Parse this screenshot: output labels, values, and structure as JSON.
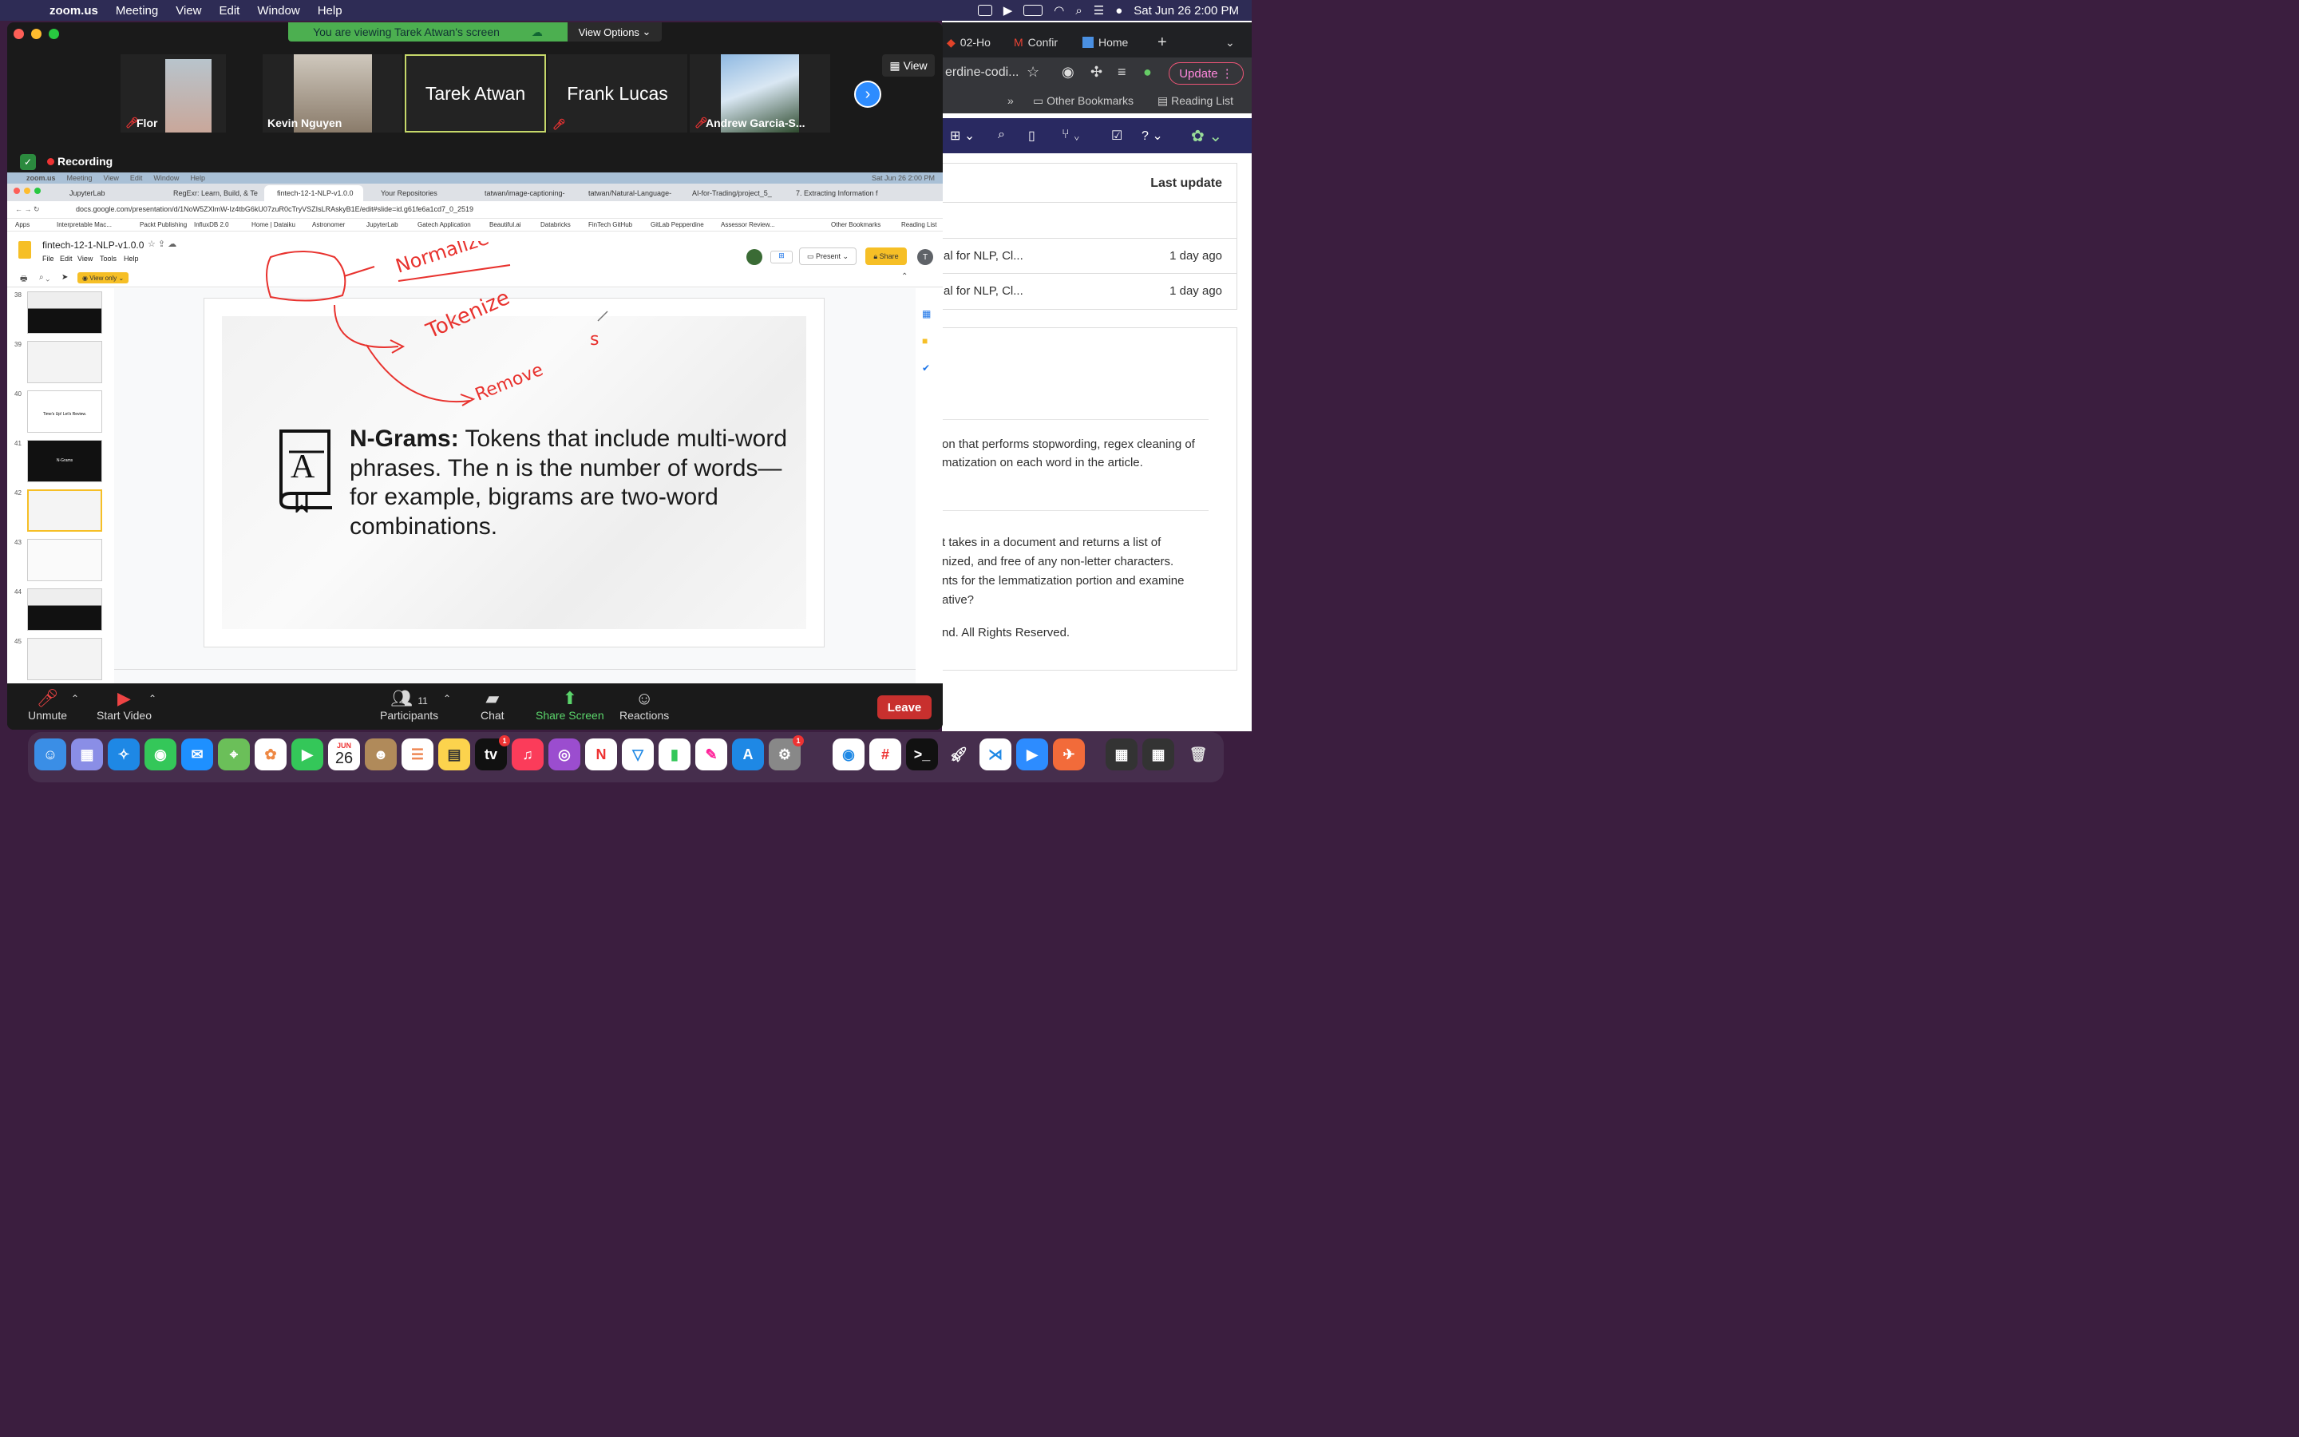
{
  "menubar": {
    "app_name": "zoom.us",
    "items": [
      "Meeting",
      "View",
      "Edit",
      "Window",
      "Help"
    ],
    "datetime": "Sat Jun 26  2:00 PM"
  },
  "zoom": {
    "viewing_banner": "You are viewing Tarek Atwan's screen",
    "view_options": "View Options",
    "view_button": "View",
    "recording": "Recording",
    "participants": [
      {
        "name": "Flor",
        "muted": true
      },
      {
        "name": "Kevin Nguyen",
        "muted": false
      },
      {
        "name": "Tarek Atwan",
        "muted": false
      },
      {
        "name": "Frank Lucas",
        "muted": true
      },
      {
        "name": "Andrew Garcia-S...",
        "muted": true
      }
    ],
    "toolbar": {
      "unmute": "Unmute",
      "start_video": "Start Video",
      "participants": "Participants",
      "participant_count": "11",
      "chat": "Chat",
      "share_screen": "Share Screen",
      "reactions": "Reactions",
      "leave": "Leave"
    }
  },
  "shared_screen": {
    "menubar": {
      "app": "zoom.us",
      "items": [
        "Meeting",
        "View",
        "Edit",
        "Window",
        "Help"
      ],
      "datetime": "Sat Jun 26  2:00 PM"
    },
    "tabs": [
      "JupyterLab",
      "RegExr: Learn, Build, & Te",
      "fintech-12-1-NLP-v1.0.0",
      "Your Repositories",
      "tatwan/image-captioning-",
      "tatwan/Natural-Language-",
      "AI-for-Trading/project_5_",
      "7. Extracting Information f"
    ],
    "url": "docs.google.com/presentation/d/1NoW5ZXlmW-Iz4tbG6kU07zuR0cTryVSZIsLRAskyB1E/edit#slide=id.g61fe6a1cd7_0_2519",
    "bookmarks": [
      "Apps",
      "Interpretable Mac...",
      "Packt Publishing",
      "InfluxDB 2.0",
      "Home | Dataiku",
      "Astronomer",
      "JupyterLab",
      "Gatech Application",
      "Beautiful.ai",
      "Databricks",
      "FinTech GitHub",
      "GitLab Pepperdine",
      "Assessor Review...",
      "Other Bookmarks",
      "Reading List"
    ],
    "doc_title": "fintech-12-1-NLP-v1.0.0",
    "doc_menu": [
      "File",
      "Edit",
      "View",
      "Tools",
      "Help"
    ],
    "present": "Present",
    "share": "Share",
    "avatar_letter": "T",
    "view_only": "View only",
    "slide_numbers": [
      "38",
      "39",
      "40",
      "41",
      "42",
      "43",
      "44",
      "45"
    ],
    "thumb_texts": {
      "t40": "Time's Up! Let's Review.",
      "t41": "N-Grams"
    },
    "slide": {
      "term": "N-Grams:",
      "definition": " Tokens that include multi-word phrases. The n is the number of words—for example, bigrams are two-word combinations."
    },
    "annotations": [
      "Normalize",
      "Tokenize",
      "Remove",
      "s"
    ]
  },
  "chrome_right": {
    "tabs": [
      "02-Ho",
      "Confir",
      "Home"
    ],
    "omnibox": "erdine-codi...",
    "update": "Update",
    "bookmarks": [
      "Other Bookmarks",
      "Reading List"
    ],
    "last_update_header": "Last update",
    "rows": [
      {
        "name": "al for NLP, Cl...",
        "updated": "1 day ago"
      },
      {
        "name": "al for NLP, Cl...",
        "updated": "1 day ago"
      }
    ],
    "text1a": "on that performs stopwording, regex cleaning of",
    "text1b": "matization on each word in the article.",
    "text2a": "t takes in a document and returns a list of",
    "text2b": "nized, and free of any non-letter characters.",
    "text2c": "nts for the lemmatization portion and examine",
    "text2d": "ative?",
    "text3": "nd. All Rights Reserved."
  },
  "dock": {
    "calendar_month": "JUN",
    "calendar_day": "26",
    "badges": {
      "tv": "1",
      "settings": "1"
    }
  },
  "colors": {
    "zoom_green": "#4caf50",
    "leave_red": "#c8302e",
    "annotation_red": "#e8322e",
    "accent_yellow": "#f6bf26"
  }
}
